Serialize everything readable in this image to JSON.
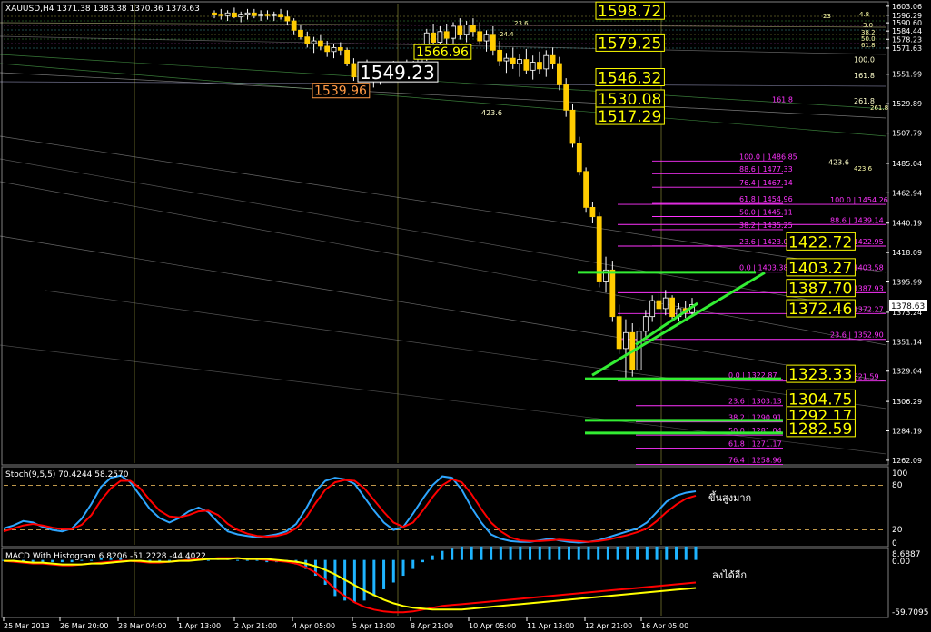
{
  "header": {
    "symbol_info": "XAUUSD,H4 1371.38 1383.38 1370.36 1378.63",
    "stoch_label": "Stoch(9,5,5) 70.4244 58.2570",
    "macd_label": "MACD With Histogram 6.8206 -51.2228 -44.4022",
    "last_price_tag": "1378.63",
    "stoch_annotation": "ขึ้นสูงมาก",
    "macd_annotation": "ลงได้อีก",
    "stoch_scale": [
      "100",
      "80",
      "20",
      "0"
    ],
    "macd_scale": [
      "8.6887",
      "0.00",
      "-59.7095"
    ]
  },
  "colors": {
    "background": "#000000",
    "bull_candle": "#000000",
    "bear_candle": "#ffcc00",
    "wick": "#ffffff",
    "grid": "#ffff66",
    "stoch_main": "#2ea6ff",
    "stoch_signal": "#ff0000",
    "macd_hist": "#1eb4ff",
    "macd_main": "#ff0000",
    "macd_signal": "#ffff00",
    "fib": "#ff33ff",
    "trend": "#33ee33",
    "label_box": "#ffff00"
  },
  "chart_data": [
    {
      "type": "candlestick",
      "title": "XAUUSD,H4",
      "price_axis_ticks": [
        1603.06,
        1596.29,
        1590.6,
        1584.44,
        1578.23,
        1571.63,
        1551.99,
        1529.89,
        1507.79,
        1485.04,
        1462.94,
        1440.19,
        1418.09,
        1395.99,
        1378.63,
        1373.24,
        1351.14,
        1329.04,
        1306.29,
        1284.19,
        1262.09
      ],
      "ylim": [
        1260,
        1605
      ],
      "x_tick_labels": [
        "25 Mar 2013",
        "26 Mar 20:00",
        "28 Mar 04:00",
        "1 Apr 13:00",
        "2 Apr 21:00",
        "4 Apr 05:00",
        "5 Apr 13:00",
        "8 Apr 21:00",
        "10 Apr 05:00",
        "11 Apr 13:00",
        "12 Apr 21:00",
        "16 Apr 05:00"
      ],
      "candles": [
        [
          1598,
          1600,
          1594,
          1597
        ],
        [
          1597,
          1601,
          1593,
          1596
        ],
        [
          1596,
          1600,
          1592,
          1598
        ],
        [
          1598,
          1602,
          1594,
          1595
        ],
        [
          1595,
          1599,
          1591,
          1597
        ],
        [
          1597,
          1601,
          1593,
          1598
        ],
        [
          1598,
          1601,
          1594,
          1596
        ],
        [
          1596,
          1600,
          1592,
          1597
        ],
        [
          1597,
          1600,
          1593,
          1596
        ],
        [
          1596,
          1599,
          1592,
          1597
        ],
        [
          1597,
          1601,
          1593,
          1595
        ],
        [
          1595,
          1600,
          1589,
          1592
        ],
        [
          1592,
          1594,
          1582,
          1585
        ],
        [
          1585,
          1589,
          1578,
          1580
        ],
        [
          1580,
          1584,
          1572,
          1575
        ],
        [
          1575,
          1580,
          1568,
          1577
        ],
        [
          1577,
          1582,
          1570,
          1573
        ],
        [
          1573,
          1577,
          1565,
          1569
        ],
        [
          1569,
          1575,
          1564,
          1572
        ],
        [
          1572,
          1576,
          1566,
          1570
        ],
        [
          1570,
          1572,
          1558,
          1560
        ],
        [
          1560,
          1564,
          1547,
          1550
        ],
        [
          1550,
          1560,
          1546,
          1558
        ],
        [
          1558,
          1563,
          1549,
          1552
        ],
        [
          1552,
          1556,
          1542,
          1547
        ],
        [
          1547,
          1557,
          1544,
          1554
        ],
        [
          1554,
          1560,
          1549,
          1556
        ],
        [
          1556,
          1562,
          1550,
          1552
        ],
        [
          1552,
          1559,
          1547,
          1557
        ],
        [
          1557,
          1563,
          1551,
          1553
        ],
        [
          1553,
          1562,
          1549,
          1560
        ],
        [
          1560,
          1569,
          1556,
          1566
        ],
        [
          1566,
          1586,
          1562,
          1583
        ],
        [
          1583,
          1590,
          1572,
          1576
        ],
        [
          1576,
          1588,
          1570,
          1584
        ],
        [
          1584,
          1590,
          1575,
          1579
        ],
        [
          1579,
          1591,
          1574,
          1588
        ],
        [
          1588,
          1594,
          1578,
          1582
        ],
        [
          1582,
          1592,
          1576,
          1589
        ],
        [
          1589,
          1594,
          1580,
          1584
        ],
        [
          1584,
          1591,
          1574,
          1577
        ],
        [
          1577,
          1585,
          1569,
          1582
        ],
        [
          1582,
          1588,
          1566,
          1570
        ],
        [
          1570,
          1577,
          1558,
          1562
        ],
        [
          1562,
          1568,
          1553,
          1564
        ],
        [
          1564,
          1572,
          1556,
          1560
        ],
        [
          1560,
          1567,
          1550,
          1563
        ],
        [
          1563,
          1571,
          1552,
          1555
        ],
        [
          1555,
          1566,
          1548,
          1561
        ],
        [
          1561,
          1569,
          1552,
          1556
        ],
        [
          1556,
          1570,
          1550,
          1566
        ],
        [
          1566,
          1572,
          1556,
          1560
        ],
        [
          1560,
          1565,
          1540,
          1544
        ],
        [
          1544,
          1549,
          1520,
          1525
        ],
        [
          1525,
          1530,
          1497,
          1500
        ],
        [
          1500,
          1505,
          1476,
          1479
        ],
        [
          1479,
          1482,
          1448,
          1452
        ],
        [
          1452,
          1456,
          1440,
          1445
        ],
        [
          1445,
          1448,
          1392,
          1396
        ],
        [
          1396,
          1415,
          1388,
          1405
        ],
        [
          1405,
          1412,
          1366,
          1370
        ],
        [
          1370,
          1379,
          1342,
          1346
        ],
        [
          1346,
          1368,
          1323,
          1358
        ],
        [
          1358,
          1365,
          1325,
          1330
        ],
        [
          1330,
          1362,
          1328,
          1359
        ],
        [
          1359,
          1375,
          1355,
          1370
        ],
        [
          1370,
          1386,
          1366,
          1382
        ],
        [
          1382,
          1388,
          1372,
          1376
        ],
        [
          1376,
          1390,
          1371,
          1384
        ],
        [
          1384,
          1386,
          1366,
          1370
        ],
        [
          1370,
          1380,
          1367,
          1376
        ],
        [
          1376,
          1382,
          1369,
          1373
        ],
        [
          1373,
          1384,
          1371,
          1379
        ]
      ],
      "price_boxes": [
        "1598.72",
        "1579.25",
        "1566.96",
        "1539.96",
        "1549.23",
        "1546.32",
        "1530.08",
        "1517.29",
        "1422.72",
        "1403.27",
        "1387.70",
        "1372.46",
        "1323.33",
        "1304.75",
        "1292.17",
        "1282.59"
      ],
      "box_prices": [
        1596,
        1572,
        1566,
        1537,
        1549,
        1546,
        1530,
        1517,
        1422.72,
        1403.27,
        1387.7,
        1372.46,
        1323.33,
        1304.75,
        1292.17,
        1282.59
      ],
      "fib_labels_a": [
        "100.0 | 1486.85",
        "88.6 | 1477.33",
        "76.4 | 1467.14",
        "61.8 | 1454.96",
        "50.0 | 1445.11",
        "38.2 | 1435.25",
        "23.6 | 1423.08",
        "0.0 | 1403.38"
      ],
      "fib_prices_a": [
        1486.85,
        1477.33,
        1467.14,
        1454.96,
        1445.11,
        1435.25,
        1423.08,
        1403.38
      ],
      "fib_labels_b": [
        "100.0 | 1454.26",
        "88.6 | 1439.14",
        "76.4 | 1422.95",
        "61.8 | 1403.58",
        "50.0 | 1387.93",
        "38.2 | 1372.27",
        "23.6 | 1352.90",
        "0.0 | 1321.59"
      ],
      "fib_prices_b": [
        1454.26,
        1439.14,
        1422.95,
        1403.58,
        1387.93,
        1372.27,
        1352.9,
        1321.59
      ],
      "fib_labels_c": [
        "0.0 | 1322.87",
        "23.6 | 1303.13",
        "38.2 | 1290.91",
        "50.0 | 1281.04",
        "61.8 | 1271.17",
        "76.4 | 1258.96"
      ],
      "fib_prices_c": [
        1322.87,
        1303.13,
        1290.91,
        1281.04,
        1271.17,
        1258.96
      ],
      "ext_labels": [
        "100.0",
        "161.8",
        "261.8",
        "423.6",
        "161.8",
        "423.6"
      ],
      "ext_prices": [
        1561,
        1549,
        1530,
        1521,
        1531,
        1484
      ],
      "green_levels": [
        1403.27,
        1323.33,
        1292.17,
        1282.59
      ],
      "trendline": [
        [
          1326,
          1403
        ]
      ],
      "misc_top_labels": [
        "4.8",
        "3.0",
        "38.2",
        "50.0",
        "61.8",
        "23",
        "423.6",
        "261.8",
        "24.4",
        "23.6"
      ]
    },
    {
      "type": "line",
      "title": "Stoch(9,5,5)",
      "ylim": [
        0,
        100
      ],
      "levels": [
        80,
        20
      ],
      "series": [
        {
          "name": "main",
          "values": [
            22,
            26,
            32,
            30,
            24,
            20,
            18,
            22,
            35,
            55,
            78,
            90,
            93,
            84,
            66,
            48,
            36,
            30,
            36,
            45,
            50,
            44,
            30,
            18,
            14,
            12,
            10,
            12,
            14,
            18,
            28,
            48,
            72,
            86,
            90,
            88,
            82,
            64,
            46,
            30,
            20,
            24,
            42,
            62,
            80,
            92,
            90,
            74,
            50,
            30,
            14,
            8,
            5,
            4,
            4,
            6,
            8,
            6,
            4,
            3,
            4,
            6,
            10,
            14,
            18,
            22,
            30,
            44,
            58,
            66,
            70,
            72
          ]
        },
        {
          "name": "signal",
          "values": [
            18,
            22,
            26,
            28,
            26,
            23,
            21,
            21,
            27,
            40,
            60,
            76,
            86,
            86,
            76,
            60,
            46,
            38,
            37,
            40,
            45,
            46,
            40,
            28,
            20,
            15,
            12,
            11,
            12,
            15,
            22,
            36,
            56,
            74,
            84,
            87,
            86,
            76,
            60,
            44,
            30,
            24,
            30,
            46,
            64,
            80,
            88,
            84,
            68,
            48,
            30,
            18,
            10,
            6,
            5,
            5,
            6,
            7,
            6,
            5,
            4,
            5,
            7,
            10,
            13,
            17,
            22,
            32,
            44,
            54,
            62,
            66
          ]
        }
      ]
    },
    {
      "type": "line",
      "title": "MACD With Histogram",
      "ylim": [
        -59.7095,
        8.6887
      ],
      "series": [
        {
          "name": "macd",
          "values": [
            -1,
            -2,
            -3,
            -4,
            -4,
            -5,
            -6,
            -6,
            -5,
            -4,
            -3,
            -2,
            -1,
            -1,
            -2,
            -3,
            -3,
            -2,
            -1,
            0,
            1,
            1,
            2,
            2,
            2,
            1,
            1,
            0,
            -1,
            -2,
            -4,
            -8,
            -14,
            -22,
            -32,
            -40,
            -47,
            -52,
            -55,
            -57,
            -58,
            -58,
            -57,
            -55,
            -53,
            -51,
            -50,
            -49,
            -48,
            -47,
            -46,
            -45,
            -44,
            -43,
            -42,
            -41,
            -40,
            -39,
            -38,
            -37,
            -36,
            -35,
            -34,
            -33,
            -32,
            -31,
            -30,
            -29,
            -28,
            -27,
            -26,
            -25
          ]
        },
        {
          "name": "signal",
          "values": [
            -1,
            -1,
            -2,
            -3,
            -3,
            -4,
            -5,
            -5,
            -5,
            -4,
            -4,
            -3,
            -2,
            -1,
            -1,
            -2,
            -2,
            -2,
            -1,
            -1,
            0,
            1,
            1,
            1,
            2,
            1,
            1,
            1,
            0,
            -1,
            -2,
            -4,
            -7,
            -11,
            -16,
            -22,
            -28,
            -34,
            -39,
            -44,
            -48,
            -51,
            -53,
            -54,
            -55,
            -55,
            -55,
            -55,
            -54,
            -53,
            -52,
            -51,
            -50,
            -49,
            -48,
            -47,
            -46,
            -45,
            -44,
            -43,
            -42,
            -41,
            -40,
            -39,
            -38,
            -37,
            -36,
            -35,
            -34,
            -33,
            -32,
            -31
          ]
        },
        {
          "name": "histogram",
          "values": [
            0,
            -1,
            -1,
            -1,
            -1,
            -1,
            -1,
            -1,
            0,
            0,
            1,
            1,
            1,
            0,
            -1,
            -1,
            -1,
            0,
            0,
            1,
            1,
            0,
            1,
            1,
            0,
            0,
            0,
            -1,
            -1,
            -1,
            -2,
            -4,
            -7,
            -11,
            -16,
            -18,
            -19,
            -18,
            -16,
            -13,
            -10,
            -7,
            -4,
            -1,
            2,
            4,
            5,
            6,
            6,
            6,
            6,
            6,
            6,
            6,
            6,
            6,
            6,
            6,
            6,
            6,
            6,
            6,
            6,
            6,
            6,
            6,
            6,
            6,
            6,
            6,
            6,
            6
          ]
        }
      ]
    }
  ]
}
